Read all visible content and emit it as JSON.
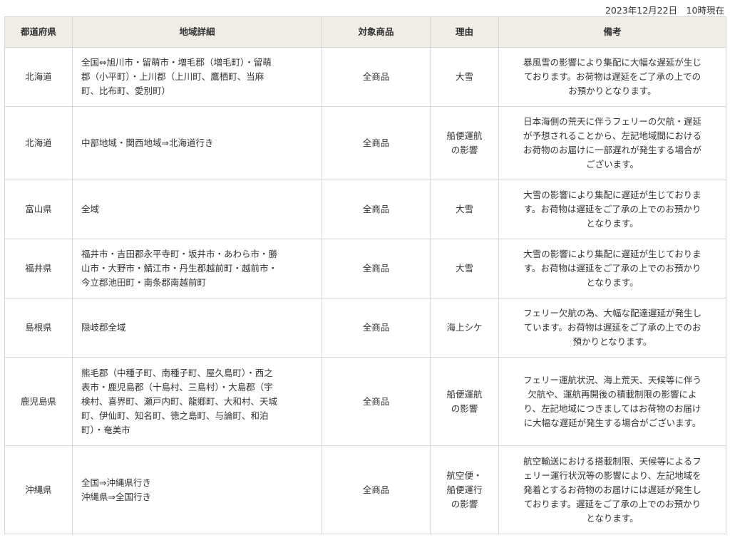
{
  "timestamp": "2023年12月22日　10時現在",
  "headers": [
    "都道府県",
    "地域詳細",
    "対象商品",
    "理由",
    "備考"
  ],
  "rows": [
    {
      "prefecture": "北海道",
      "area_lines": [
        "全国⇔旭川市・留萌市・増毛郡（増毛町）・留萌",
        "郡（小平町）・上川郡（上川町、鷹栖町、当麻",
        "町、比布町、愛別町）"
      ],
      "product": "全商品",
      "reason_lines": [
        "大雪"
      ],
      "note_lines": [
        "暴風雪の影響により集配に大幅な遅延が生じ",
        "ております。お荷物は遅延をご了承の上での",
        "お預かりとなります。"
      ]
    },
    {
      "prefecture": "北海道",
      "area_lines": [
        "中部地域・関西地域⇒北海道行き"
      ],
      "product": "全商品",
      "reason_lines": [
        "船便運航",
        "の影響"
      ],
      "note_lines": [
        "日本海側の荒天に伴うフェリーの欠航・遅延",
        "が予想されることから、左記地域間における",
        "お荷物のお届けに一部遅れが発生する場合が",
        "ございます。"
      ]
    },
    {
      "prefecture": "富山県",
      "area_lines": [
        "全域"
      ],
      "product": "全商品",
      "reason_lines": [
        "大雪"
      ],
      "note_lines": [
        "大雪の影響により集配に遅延が生じておりま",
        "す。お荷物は遅延をご了承の上でのお預かり",
        "となります。"
      ]
    },
    {
      "prefecture": "福井県",
      "area_lines": [
        "福井市・吉田郡永平寺町・坂井市・あわら市・勝",
        "山市・大野市・鯖江市・丹生郡越前町・越前市・",
        "今立郡池田町・南条郡南越前町"
      ],
      "product": "全商品",
      "reason_lines": [
        "大雪"
      ],
      "note_lines": [
        "大雪の影響により集配に遅延が生じておりま",
        "す。お荷物は遅延をご了承の上でのお預かり",
        "となります。"
      ]
    },
    {
      "prefecture": "島根県",
      "area_lines": [
        "隠岐郡全域"
      ],
      "product": "全商品",
      "reason_lines": [
        "海上シケ"
      ],
      "note_lines": [
        "フェリー欠航の為、大幅な配達遅延が発生し",
        "ています。お荷物は遅延をご了承の上でのお",
        "預かりとなります。"
      ]
    },
    {
      "prefecture": "鹿児島県",
      "area_lines": [
        "熊毛郡（中種子町、南種子町、屋久島町）・西之",
        "表市・鹿児島郡（十島村、三島村）・大島郡（宇",
        "検村、喜界町、瀬戸内町、龍郷町、大和村、天城",
        "町、伊仙町、知名町、徳之島町、与論町、和泊",
        "町）・奄美市"
      ],
      "product": "全商品",
      "reason_lines": [
        "船便運航",
        "の影響"
      ],
      "note_lines": [
        "フェリー運航状況、海上荒天、天候等に伴う",
        "欠航や、運航再開後の積載制限の影響によ",
        "り、左記地域につきましてはお荷物のお届け",
        "に大幅な遅延が発生する場合がございます。"
      ]
    },
    {
      "prefecture": "沖縄県",
      "area_lines": [
        "全国⇒沖縄県行き",
        "沖縄県⇒全国行き"
      ],
      "product": "全商品",
      "reason_lines": [
        "航空便・",
        "船便運行",
        "の影響"
      ],
      "note_lines": [
        "航空輸送における搭載制限、天候等によるフ",
        "ェリー運行状況等の影響により、左記地域を",
        "発着とするお荷物のお届けには遅延が発生し",
        "ております。遅延をご了承の上でのお預かり",
        "となります。"
      ]
    }
  ]
}
